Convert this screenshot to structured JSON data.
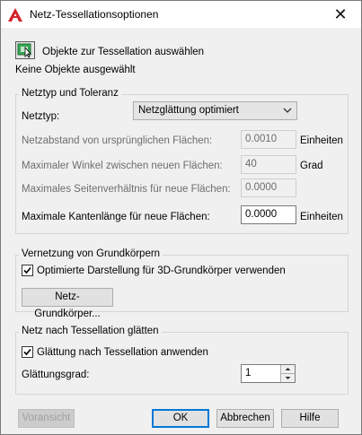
{
  "window": {
    "title": "Netz-Tessellationsoptionen",
    "close_symbol": "✕"
  },
  "selection": {
    "button_label": "Objekte zur Tessellation auswählen",
    "status": "Keine Objekte ausgewählt"
  },
  "mesh_type": {
    "group_title": "Netztyp und Toleranz",
    "type_label": "Netztyp:",
    "type_value": "Netzglättung optimiert",
    "distance_label": "Netzabstand von ursprünglichen Flächen:",
    "distance_value": "0.0010",
    "distance_unit": "Einheiten",
    "angle_label": "Maximaler Winkel zwischen neuen Flächen:",
    "angle_value": "40",
    "angle_unit": "Grad",
    "aspect_label": "Maximales Seitenverhältnis für neue Flächen:",
    "aspect_value": "0.0000",
    "edge_label": "Maximale Kantenlänge für neue Flächen:",
    "edge_value": "0.0000",
    "edge_unit": "Einheiten"
  },
  "primitives": {
    "group_title": "Vernetzung von Grundkörpern",
    "checkbox_label": "Optimierte Darstellung für 3D-Grundkörper verwenden",
    "checked": true,
    "button_label": "Netz-Grundkörper..."
  },
  "smoothing": {
    "group_title": "Netz nach Tessellation glätten",
    "checkbox_label": "Glättung nach Tessellation anwenden",
    "checked": true,
    "degree_label": "Glättungsgrad:",
    "degree_value": "1"
  },
  "footer": {
    "preview": "Voransicht",
    "ok": "OK",
    "cancel": "Abbrechen",
    "help": "Hilfe"
  },
  "colors": {
    "app_icon": "#d2232a",
    "default_button_border": "#0078d7"
  },
  "icons": {
    "app": "autocad-logo-icon",
    "select": "select-objects-icon"
  }
}
